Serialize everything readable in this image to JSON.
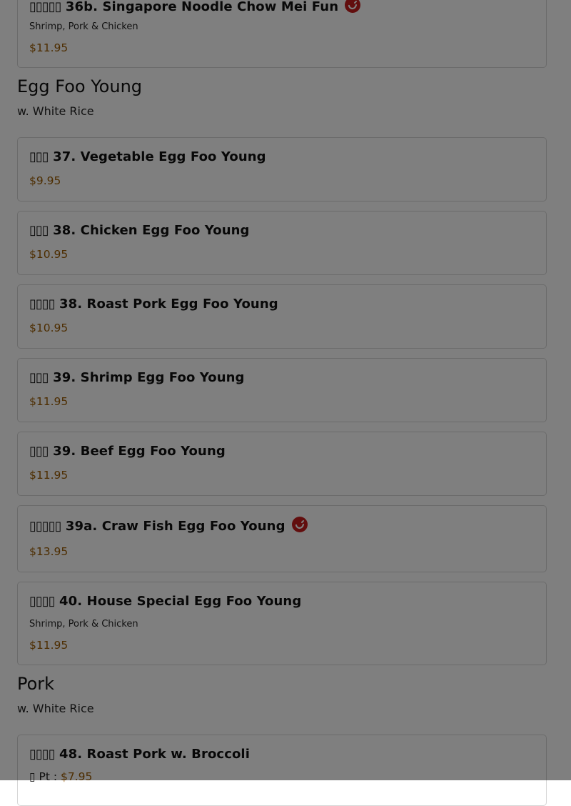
{
  "colors": {
    "price": "#9a5a00",
    "spicy": "#c51d1d",
    "overlay": "rgba(0,0,0,0.5)"
  },
  "sections": {
    "egg_foo_young": {
      "title": "Egg Foo Young",
      "subtitle": "w. White Rice"
    },
    "pork": {
      "title": "Pork",
      "subtitle": "w. White Rice"
    }
  },
  "items": [
    {
      "glyphs": "▯▯▯▯▯",
      "name": "36b. Singapore Noodle Chow Mei Fun",
      "desc": "Shrimp, Pork & Chicken",
      "price": "$11.95",
      "icon": "spicy-pepper-icon"
    },
    {
      "glyphs": "▯▯▯",
      "name": "37. Vegetable Egg Foo Young",
      "price": "$9.95"
    },
    {
      "glyphs": "▯▯▯",
      "name": "38. Chicken Egg Foo Young",
      "price": "$10.95"
    },
    {
      "glyphs": "▯▯▯▯",
      "name": "38. Roast Pork Egg Foo Young",
      "price": "$10.95"
    },
    {
      "glyphs": "▯▯▯",
      "name": "39. Shrimp Egg Foo Young",
      "price": "$11.95"
    },
    {
      "glyphs": "▯▯▯",
      "name": "39. Beef Egg Foo Young",
      "price": "$11.95"
    },
    {
      "glyphs": "▯▯▯▯▯",
      "name": "39a. Craw Fish Egg Foo Young",
      "price": "$13.95",
      "icon": "spicy-pepper-icon"
    },
    {
      "glyphs": "▯▯▯▯",
      "name": "40. House Special Egg Foo Young",
      "desc": "Shrimp, Pork & Chicken",
      "price": "$11.95"
    },
    {
      "glyphs": "▯▯▯▯",
      "name": "48. Roast Pork w. Broccoli",
      "size_glyph": "▯",
      "size_label": "Pt :",
      "price": "$7.95"
    }
  ]
}
